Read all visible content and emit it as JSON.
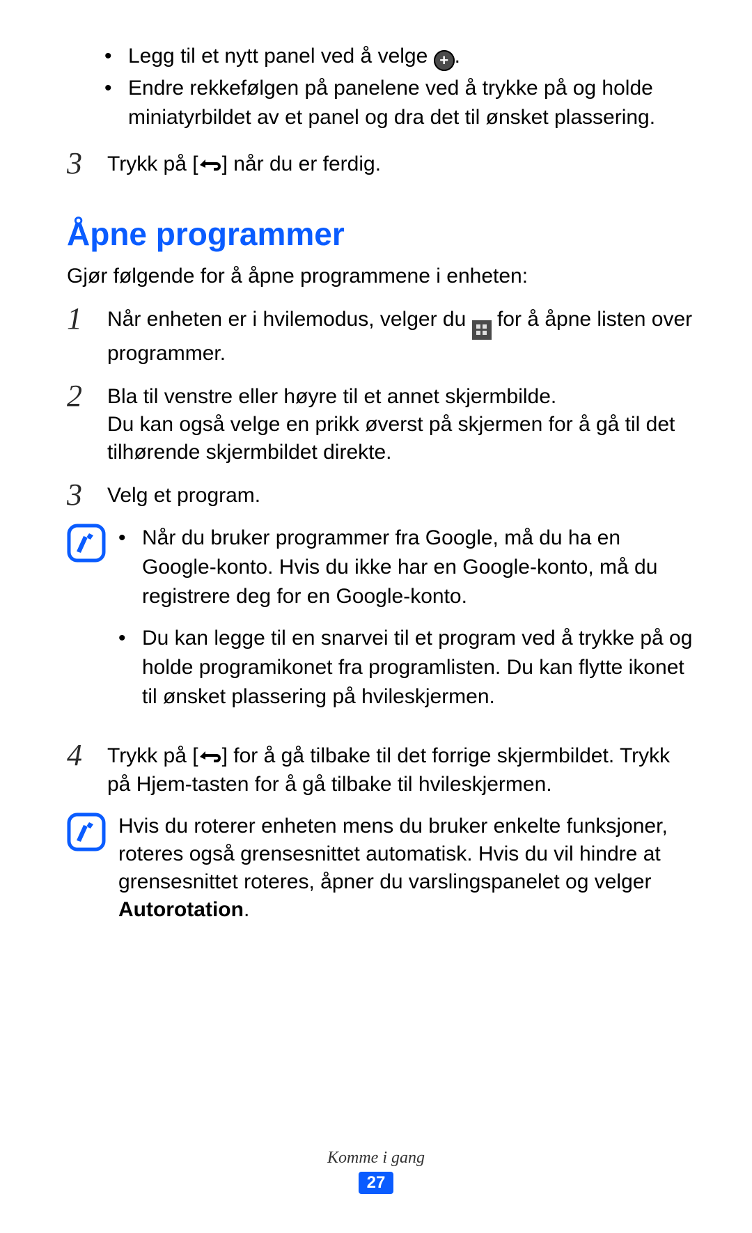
{
  "top_bullets": {
    "b1_pre": "Legg til et nytt panel ved å velge ",
    "b1_post": ".",
    "b2": "Endre rekkefølgen på panelene ved å trykke på og holde miniatyrbildet av et panel og dra det til ønsket plassering."
  },
  "top_step3": {
    "num": "3",
    "pre": "Trykk på [",
    "post": "] når du er ferdig."
  },
  "heading": "Åpne programmer",
  "intro": "Gjør følgende for å åpne programmene i enheten:",
  "step1": {
    "num": "1",
    "pre": "Når enheten er i hvilemodus, velger du ",
    "post": " for å åpne listen over programmer."
  },
  "step2": {
    "num": "2",
    "line1": "Bla til venstre eller høyre til et annet skjermbilde.",
    "line2": "Du kan også velge en prikk øverst på skjermen for å gå til det tilhørende skjermbildet direkte."
  },
  "step3": {
    "num": "3",
    "text": "Velg et program."
  },
  "note1": {
    "b1": "Når du bruker programmer fra Google, må du ha en Google-konto. Hvis du ikke har en Google-konto, må du registrere deg for en Google-konto.",
    "b2": "Du kan legge til en snarvei til et program ved å trykke på og holde programikonet fra programlisten. Du kan flytte ikonet til ønsket plassering på hvileskjermen."
  },
  "step4": {
    "num": "4",
    "pre": "Trykk på [",
    "mid": "] for å gå tilbake til det forrige skjermbildet. Trykk på Hjem-tasten for å gå tilbake til hvileskjermen."
  },
  "note2": {
    "text_pre": "Hvis du roterer enheten mens du bruker enkelte funksjoner, roteres også grensesnittet automatisk. Hvis du vil hindre at grensesnittet roteres, åpner du varslingspanelet og velger ",
    "bold": "Autorotation",
    "text_post": "."
  },
  "footer": {
    "section": "Komme i gang",
    "page": "27"
  }
}
